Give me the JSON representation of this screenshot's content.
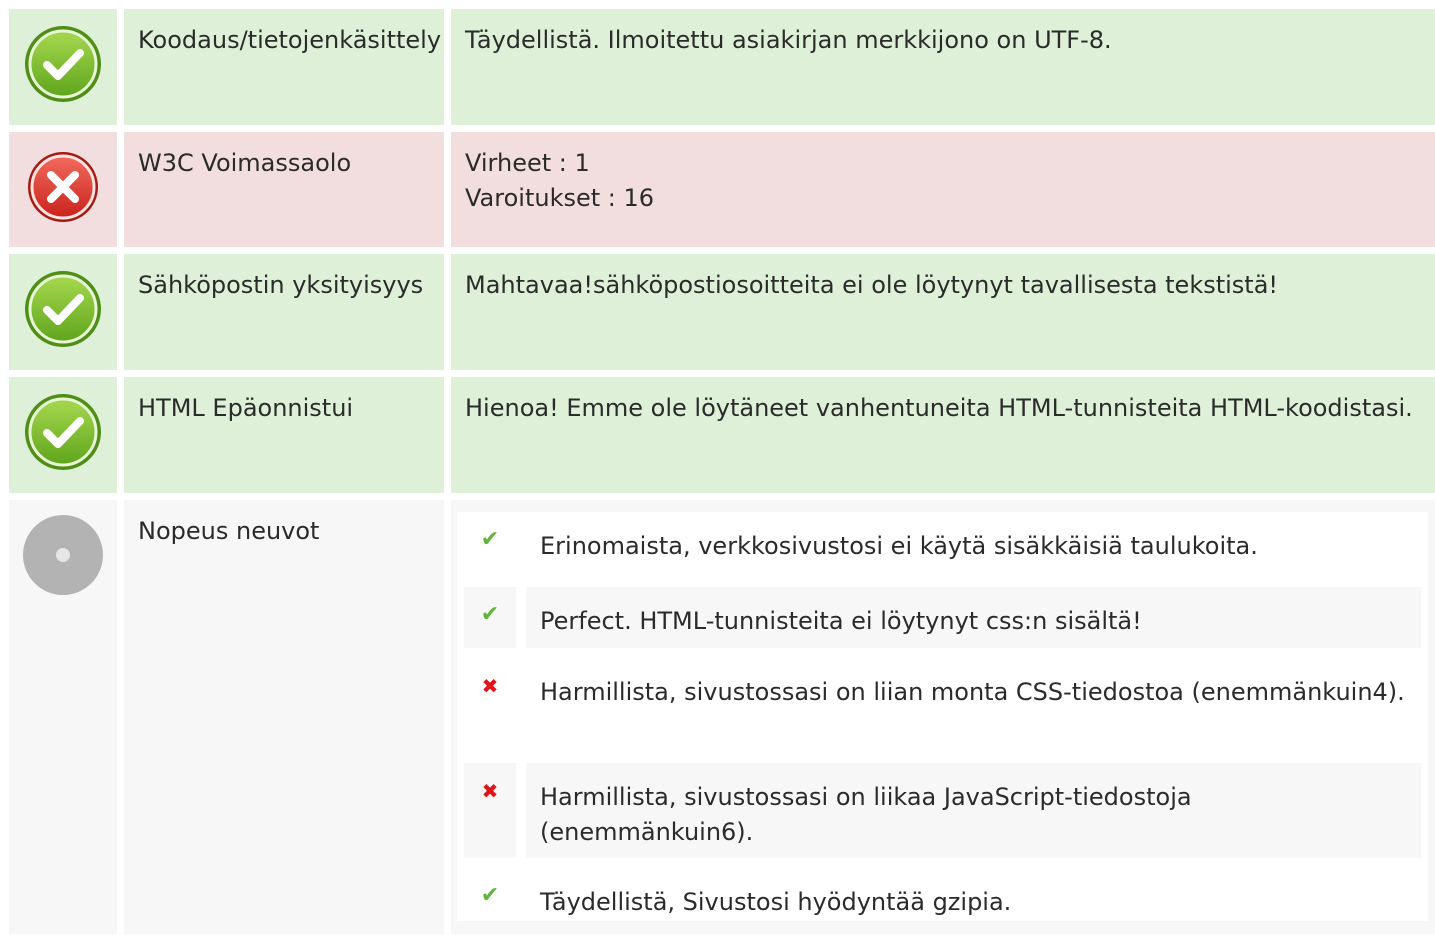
{
  "rows": [
    {
      "status": "ok",
      "label": "Koodaus/tietojenkäsittely",
      "value": "Täydellistä. Ilmoitettu asiakirjan merkkijono on UTF-8."
    },
    {
      "status": "error",
      "label": "W3C Voimassaolo",
      "errors_line": "Virheet : 1",
      "warnings_line": "Varoitukset : 16"
    },
    {
      "status": "ok",
      "label": "Sähköpostin yksityisyys",
      "value": "Mahtavaa!sähköpostiosoitteita ei ole löytynyt tavallisesta tekstistä!"
    },
    {
      "status": "ok",
      "label": "HTML Epäonnistui",
      "value": "Hienoa! Emme ole löytäneet vanhentuneita HTML-tunnisteita HTML-koodistasi."
    },
    {
      "status": "neutral",
      "label": "Nopeus neuvot",
      "tips": [
        {
          "status": "pass",
          "text": "Erinomaista, verkkosivustosi ei käytä sisäkkäisiä taulukoita."
        },
        {
          "status": "pass",
          "text": "Perfect. HTML-tunnisteita ei löytynyt css:n sisältä!"
        },
        {
          "status": "fail",
          "text": "Harmillista, sivustossasi on liian monta CSS-tiedostoa (enemmänkuin4)."
        },
        {
          "status": "fail",
          "text": "Harmillista, sivustossasi on liikaa JavaScript-tiedostoja (enemmänkuin6)."
        },
        {
          "status": "pass",
          "text": "Täydellistä, Sivustosi hyödyntää gzipia."
        }
      ]
    }
  ],
  "icons": {
    "ok": "check-circle-icon",
    "error": "x-circle-icon",
    "neutral": "gray-disc-icon",
    "pass": "check-icon",
    "fail": "cross-icon"
  },
  "colors": {
    "ok_background": "#dff0d8",
    "error_background": "#f2dede",
    "neutral_background": "#f7f7f7",
    "check_green": "#62b53b",
    "cross_red": "#e0151b"
  }
}
